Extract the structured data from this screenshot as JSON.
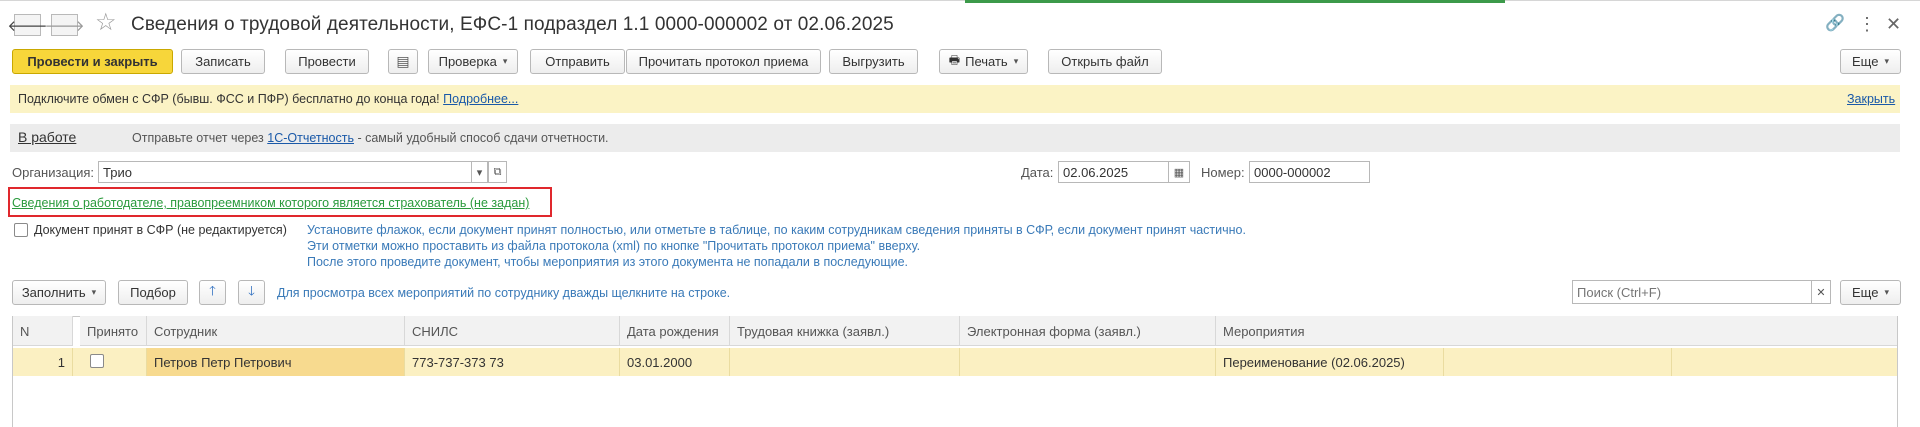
{
  "window": {
    "title": "Сведения о трудовой деятельности, ЕФС-1 подраздел 1.1 0000-000002 от 02.06.2025",
    "back_icon": "arrow-left",
    "forward_icon": "arrow-right",
    "favorite_icon": "star",
    "link_icon": "link",
    "menu_icon": "vertical-dots",
    "close_icon": "close"
  },
  "toolbar": {
    "post_close": "Провести и закрыть",
    "save": "Записать",
    "post": "Провести",
    "check": "Проверка",
    "send": "Отправить",
    "read_protocol": "Прочитать протокол приема",
    "upload": "Выгрузить",
    "print": "Печать",
    "open_file": "Открыть файл",
    "more": "Еще"
  },
  "banner": {
    "text": "Подключите обмен с СФР (бывш. ФСС и ПФР) бесплатно до конца года!",
    "more_link": "Подробнее...",
    "close_link": "Закрыть"
  },
  "status": {
    "label": "В работе",
    "text_before": "Отправьте отчет через",
    "link": "1С-Отчетность",
    "text_after": "- самый удобный способ сдачи отчетности."
  },
  "form": {
    "org_label": "Организация:",
    "org_value": "Трио",
    "date_label": "Дата:",
    "date_value": "02.06.2025",
    "number_label": "Номер:",
    "number_value": "0000-000002",
    "employer_link": "Сведения о работодателе, правопреемником которого является страхователь (не задан)",
    "accepted_label": "Документ принят в СФР (не редактируется)",
    "accepted_checked": false,
    "hint_lines": [
      "Установите флажок, если документ принят полностью, или отметьте в таблице, по каким сотрудникам сведения приняты в СФР, если документ принят частично.",
      "Эти отметки можно проставить из файла протокола (xml) по кнопке \"Прочитать протокол приема\" вверху.",
      "После этого проведите документ, чтобы мероприятия из этого документа не попадали в последующие."
    ]
  },
  "table_toolbar": {
    "fill": "Заполнить",
    "select": "Подбор",
    "hint": "Для просмотра всех мероприятий по сотруднику дважды щелкните на строке.",
    "search_placeholder": "Поиск (Ctrl+F)",
    "more": "Еще"
  },
  "table": {
    "columns": [
      "N",
      "Принято",
      "Сотрудник",
      "СНИЛС",
      "Дата рождения",
      "Трудовая книжка (заявл.)",
      "Электронная форма (заявл.)",
      "Мероприятия"
    ],
    "rows": [
      {
        "n": "1",
        "accepted": false,
        "employee": "Петров Петр Петрович",
        "snils": "773-737-373 73",
        "birth_date": "03.01.2000",
        "work_book": "",
        "electronic_form": "",
        "events": "Переименование (02.06.2025)"
      }
    ]
  },
  "colors": {
    "primary_button": "#f7d63a",
    "banner_bg": "#fbf3c5",
    "link": "#1a59a8",
    "employer_link": "#2a9a3c",
    "highlight_box": "#e0282d",
    "hint_text": "#3a7ab8",
    "row_bg": "#fbf0c2"
  }
}
